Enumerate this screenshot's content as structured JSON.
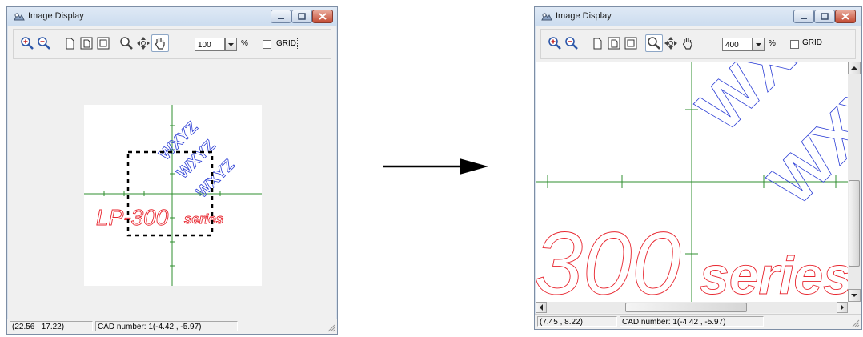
{
  "left_window": {
    "title": "Image Display",
    "zoom_value": "100",
    "zoom_unit": "%",
    "grid_label": "GRID",
    "grid_checked": false,
    "coords": "(22.56 , 17.22)",
    "cad_info": "CAD number: 1(-4.42 , -5.97)",
    "image_text_main": "LP-300",
    "image_text_suffix": "series",
    "rotated_text": "WXYZ"
  },
  "right_window": {
    "title": "Image Display",
    "zoom_value": "400",
    "zoom_unit": "%",
    "grid_label": "GRID",
    "grid_checked": false,
    "coords": "(7.45 , 8.22)",
    "cad_info": "CAD number: 1(-4.42 , -5.97)",
    "image_text_main": "300",
    "image_text_suffix": "series",
    "rotated_text": "WXYZ"
  },
  "arrow": "right-arrow",
  "colors": {
    "axis": "#2f8f2f",
    "outline_text_red": "#e8262f",
    "outline_text_blue": "#2d3fd6",
    "selection_box": "#000000"
  },
  "icons": [
    "zoom-in-icon",
    "zoom-out-icon",
    "page-icon",
    "fit-page-icon",
    "fit-window-icon",
    "zoom-select-icon",
    "pan-move-icon",
    "hand-grab-icon"
  ]
}
